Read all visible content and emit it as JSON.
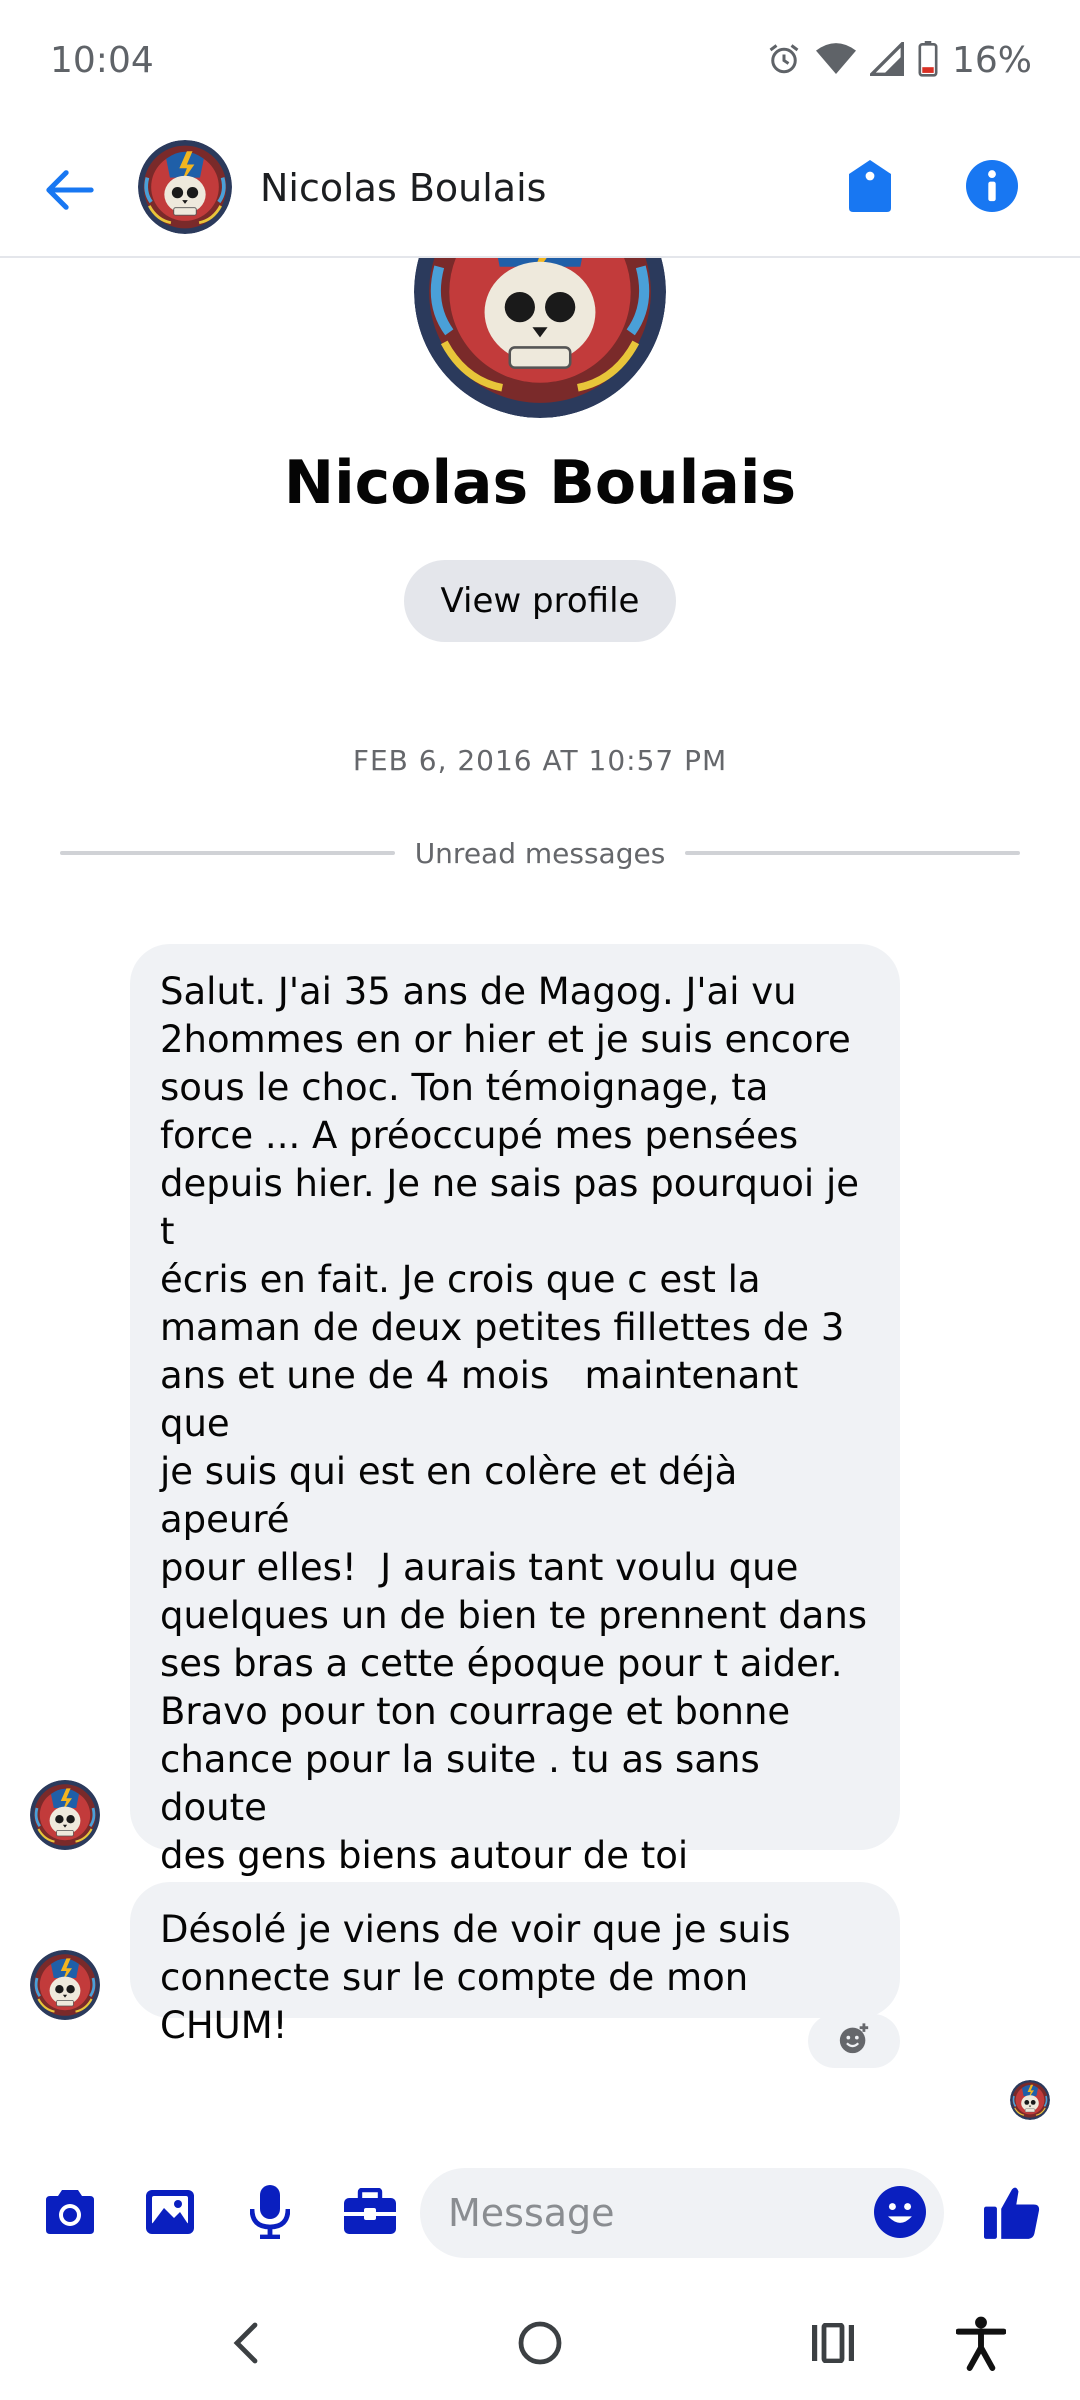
{
  "status_bar": {
    "time": "10:04",
    "battery": "16%",
    "icons": [
      "alarm-icon",
      "wifi-icon",
      "cell-signal-icon",
      "battery-icon"
    ]
  },
  "header": {
    "contact_name": "Nicolas Boulais",
    "icons": [
      "back-arrow-icon",
      "tag-icon",
      "info-icon"
    ]
  },
  "profile": {
    "name": "Nicolas Boulais",
    "view_profile_label": "View profile"
  },
  "timestamp": "FEB 6, 2016 AT 10:57 PM",
  "unread_label": "Unread messages",
  "messages": [
    {
      "text": "Salut. J'ai 35 ans de Magog. J'ai vu\n2hommes en or hier et je suis encore\nsous le choc. Ton témoignage, ta\nforce ... A préoccupé mes pensées\ndepuis hier. Je ne sais pas pourquoi je t\nécris en fait. Je crois que c est la\nmaman de deux petites fillettes de 3\nans et une de 4 mois   maintenant que\nje suis qui est en colère et déjà apeuré\npour elles!  J aurais tant voulu que\nquelques un de bien te prennent dans\nses bras a cette époque pour t aider.\nBravo pour ton courrage et bonne\nchance pour la suite . tu as sans doute\ndes gens biens autour de toi\nmaintenant. Je l espère. Embrasse la\npetite SN que je crois avoir reconnu.\nMarianne"
    },
    {
      "text": "Désolé je viens de voir que je suis\nconnecte sur le compte de mon CHUM!"
    }
  ],
  "composer": {
    "placeholder": "Message",
    "icons": [
      "camera-icon",
      "gallery-icon",
      "microphone-icon",
      "briefcase-icon",
      "emoji-icon",
      "thumbs-up-icon"
    ]
  },
  "nav_bar": {
    "icons": [
      "nav-back-icon",
      "nav-home-icon",
      "nav-recents-icon",
      "accessibility-icon"
    ]
  },
  "colors": {
    "accent": "#0a1fbf",
    "header_blue": "#1877f2",
    "bubble": "#f0f2f5",
    "button_gray": "#e4e6eb"
  }
}
